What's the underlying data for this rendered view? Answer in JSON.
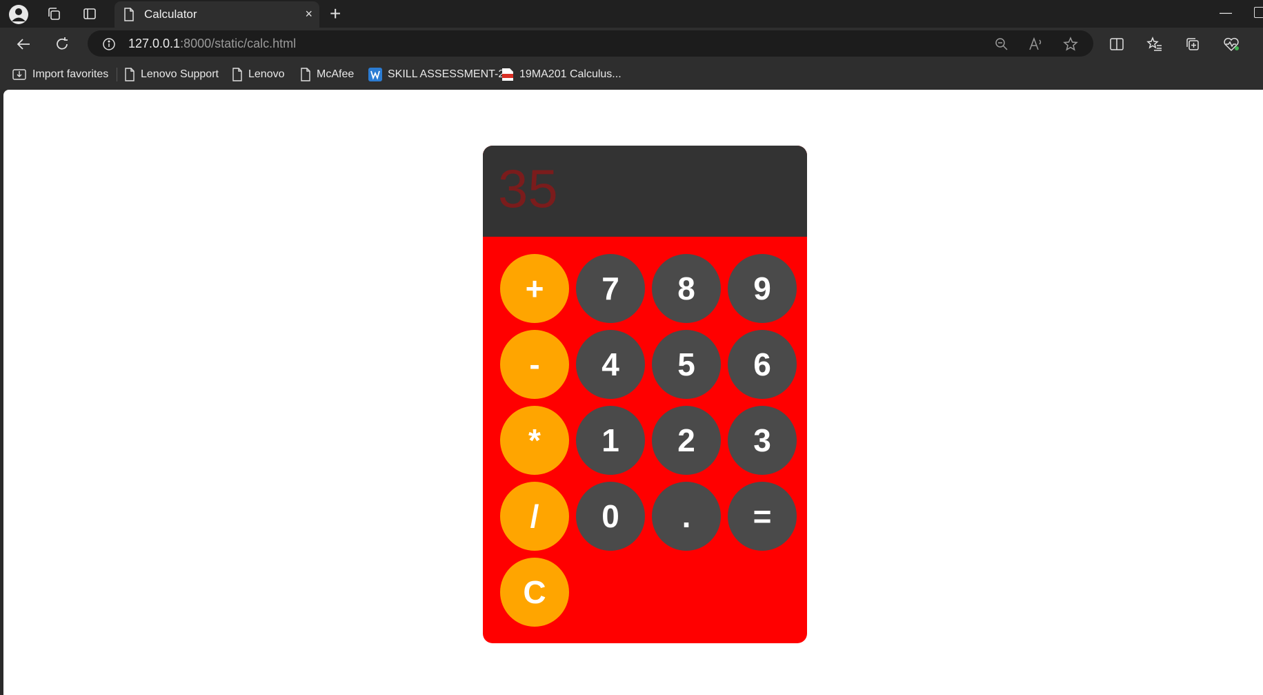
{
  "browser": {
    "tab_title": "Calculator",
    "url_host": "127.0.0.1",
    "url_rest": ":8000/static/calc.html",
    "new_tab_glyph": "+",
    "close_glyph": "×",
    "minimize_glyph": "—"
  },
  "bookmarks": [
    {
      "label": "Import favorites",
      "icon": "import-icon"
    },
    {
      "label": "Lenovo Support",
      "icon": "page-icon"
    },
    {
      "label": "Lenovo",
      "icon": "page-icon"
    },
    {
      "label": "McAfee",
      "icon": "page-icon"
    },
    {
      "label": "SKILL ASSESSMENT-2",
      "icon": "word-doc-icon"
    },
    {
      "label": "19MA201 Calculus...",
      "icon": "pdf-icon"
    }
  ],
  "calculator": {
    "display": "35",
    "keys": {
      "plus": "+",
      "seven": "7",
      "eight": "8",
      "nine": "9",
      "minus": "-",
      "four": "4",
      "five": "5",
      "six": "6",
      "multiply": "*",
      "one": "1",
      "two": "2",
      "three": "3",
      "divide": "/",
      "zero": "0",
      "dot": ".",
      "equals": "=",
      "clear": "C"
    },
    "colors": {
      "body": "#ff0000",
      "display_bg": "#333333",
      "display_text": "#7a1c1c",
      "operator_key": "#ffa500",
      "number_key": "#4a4a4a"
    }
  }
}
